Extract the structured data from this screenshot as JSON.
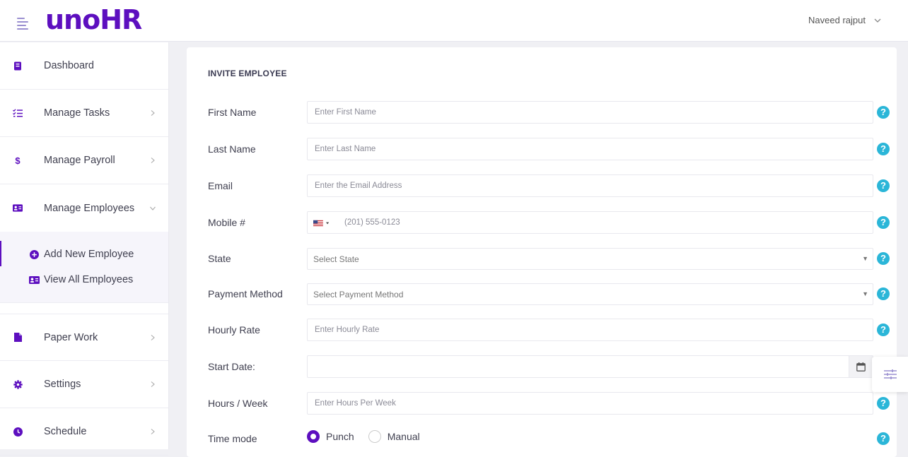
{
  "header": {
    "logo": "unoHR",
    "user_name": "Naveed rajput"
  },
  "sidebar": {
    "items": [
      {
        "label": "Dashboard",
        "icon": "dashboard-icon"
      },
      {
        "label": "Manage Tasks",
        "icon": "tasks-icon"
      },
      {
        "label": "Manage Payroll",
        "icon": "dollar-icon"
      },
      {
        "label": "Manage Employees",
        "icon": "id-card-icon",
        "expanded": true
      },
      {
        "label": "Paper Work",
        "icon": "file-icon"
      },
      {
        "label": "Settings",
        "icon": "gear-icon"
      },
      {
        "label": "Schedule",
        "icon": "clock-icon"
      }
    ],
    "submenu": [
      {
        "label": "Add New Employee",
        "icon": "plus-circle-icon",
        "active": true
      },
      {
        "label": "View All Employees",
        "icon": "id-card-icon"
      }
    ]
  },
  "form": {
    "title": "INVITE EMPLOYEE",
    "first_name": {
      "label": "First Name",
      "placeholder": "Enter First Name"
    },
    "last_name": {
      "label": "Last Name",
      "placeholder": "Enter Last Name"
    },
    "email": {
      "label": "Email",
      "placeholder": "Enter the Email Address"
    },
    "mobile": {
      "label": "Mobile #",
      "placeholder": "(201) 555-0123",
      "country": "US"
    },
    "state": {
      "label": "State",
      "selected": "Select State"
    },
    "payment_method": {
      "label": "Payment Method",
      "selected": "Select Payment Method"
    },
    "hourly_rate": {
      "label": "Hourly Rate",
      "placeholder": "Enter Hourly Rate"
    },
    "start_date": {
      "label": "Start Date:",
      "value": ""
    },
    "hours_week": {
      "label": "Hours / Week",
      "placeholder": "Enter Hours Per Week"
    },
    "time_mode": {
      "label": "Time mode",
      "options": [
        "Punch",
        "Manual"
      ],
      "selected": "Punch"
    },
    "help_symbol": "?"
  },
  "colors": {
    "brand": "#5d0fbf",
    "help": "#2bb6d8"
  }
}
